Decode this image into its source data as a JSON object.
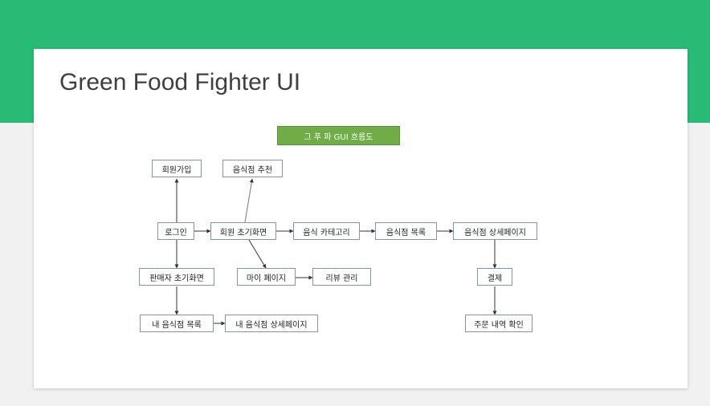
{
  "slide": {
    "title": "Green Food Fighter UI",
    "diagram_header": "그 푸 파 GUI 흐름도"
  },
  "diagram": {
    "nodes": {
      "signup": "회원가입",
      "recommend": "음식점 추천",
      "login": "로그인",
      "member_home": "회원 초기화면",
      "food_category": "음식 카테고리",
      "restaurant_list": "음식점 목록",
      "restaurant_detail": "음식점 상세페이지",
      "seller_home": "판매자 초기화면",
      "my_page": "마이 페이지",
      "review_manage": "리뷰 관리",
      "payment": "결제",
      "my_restaurant_list": "내 음식점 목록",
      "my_restaurant_detail": "내 음식점 상세페이지",
      "order_history": "주문 내역 확인"
    },
    "edges": [
      {
        "from": "login",
        "to": "signup"
      },
      {
        "from": "login",
        "to": "member_home"
      },
      {
        "from": "member_home",
        "to": "recommend"
      },
      {
        "from": "member_home",
        "to": "food_category"
      },
      {
        "from": "food_category",
        "to": "restaurant_list"
      },
      {
        "from": "restaurant_list",
        "to": "restaurant_detail"
      },
      {
        "from": "member_home",
        "to": "my_page"
      },
      {
        "from": "my_page",
        "to": "review_manage"
      },
      {
        "from": "login",
        "to": "seller_home"
      },
      {
        "from": "seller_home",
        "to": "my_restaurant_list"
      },
      {
        "from": "my_restaurant_list",
        "to": "my_restaurant_detail"
      },
      {
        "from": "restaurant_detail",
        "to": "payment"
      },
      {
        "from": "payment",
        "to": "order_history"
      }
    ]
  }
}
